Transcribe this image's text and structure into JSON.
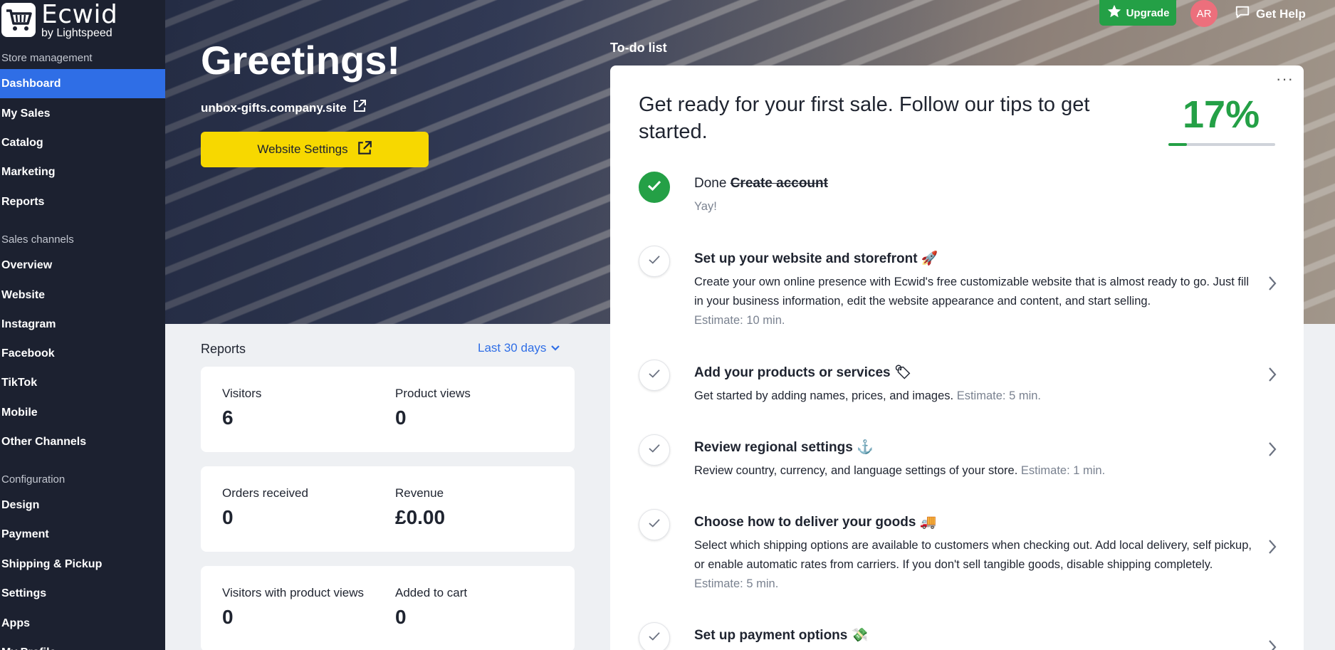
{
  "brand": {
    "name": "Ecwid",
    "sub": "by Lightspeed"
  },
  "sidebar": {
    "sections": [
      {
        "label": "Store management"
      },
      {
        "label": "Sales channels"
      },
      {
        "label": "Configuration"
      }
    ],
    "items": [
      {
        "label": "Dashboard",
        "active": true
      },
      {
        "label": "My Sales"
      },
      {
        "label": "Catalog"
      },
      {
        "label": "Marketing"
      },
      {
        "label": "Reports"
      },
      {
        "label": "Overview"
      },
      {
        "label": "Website"
      },
      {
        "label": "Instagram"
      },
      {
        "label": "Facebook"
      },
      {
        "label": "TikTok"
      },
      {
        "label": "Mobile"
      },
      {
        "label": "Other Channels"
      },
      {
        "label": "Design"
      },
      {
        "label": "Payment"
      },
      {
        "label": "Shipping & Pickup"
      },
      {
        "label": "Settings"
      },
      {
        "label": "Apps"
      },
      {
        "label": "My Profile"
      }
    ]
  },
  "topbar": {
    "upgrade": "Upgrade",
    "avatar": "AR",
    "help": "Get Help"
  },
  "hero": {
    "greeting": "Greetings!",
    "store_url": "unbox-gifts.company.site",
    "website_settings": "Website Settings"
  },
  "reports": {
    "title": "Reports",
    "period": "Last 30 days",
    "cards": [
      {
        "left_label": "Visitors",
        "left_value": "6",
        "right_label": "Product views",
        "right_value": "0"
      },
      {
        "left_label": "Orders received",
        "left_value": "0",
        "right_label": "Revenue",
        "right_value": "£0.00"
      },
      {
        "left_label": "Visitors with product views",
        "left_value": "0",
        "right_label": "Added to cart",
        "right_value": "0"
      }
    ]
  },
  "todo": {
    "title": "To-do list",
    "heading": "Get ready for your first sale. Follow our tips to get started.",
    "progress": "17%",
    "progress_fraction": 0.17,
    "menu": "···",
    "tasks": [
      {
        "done_label": "Done",
        "title": "Create account",
        "desc": "Yay!",
        "estimate": "",
        "emoji": ""
      },
      {
        "title": "Set up your website and storefront",
        "emoji": "🚀",
        "desc": "Create your own online presence with Ecwid's free customizable website that is almost ready to go. Just fill in your business information, edit the website appearance and content, and start selling.",
        "estimate": "Estimate: 10 min."
      },
      {
        "title": "Add your products or services",
        "emoji": "🏷",
        "desc": "Get started by adding names, prices, and images.",
        "estimate": "Estimate: 5 min."
      },
      {
        "title": "Review regional settings",
        "emoji": "⚓",
        "desc": "Review country, currency, and language settings of your store.",
        "estimate": "Estimate: 1 min."
      },
      {
        "title": "Choose how to deliver your goods",
        "emoji": "🚚",
        "desc": "Select which shipping options are available to customers when checking out. Add local delivery, self pickup, or enable automatic rates from carriers. If you don't sell tangible goods, disable shipping completely.",
        "estimate": "Estimate: 5 min."
      },
      {
        "title": "Set up payment options",
        "emoji": "💸",
        "desc": "",
        "estimate": ""
      }
    ]
  },
  "colors": {
    "sidebar_bg": "#1c2130",
    "active": "#2f6ee6",
    "accent_green": "#24a046",
    "button_yellow": "#f7d800",
    "avatar": "#ec6f7c"
  }
}
